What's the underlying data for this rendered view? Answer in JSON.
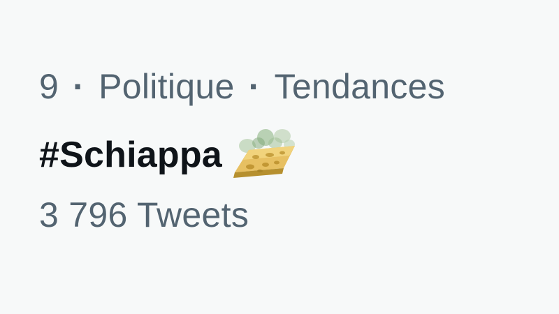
{
  "trend": {
    "rank": "9",
    "separator": "·",
    "category": "Politique",
    "section": "Tendances",
    "hashtag": "#Schiappa",
    "emoji": "cheese-icon",
    "tweet_count": "3 796",
    "tweet_label": "Tweets"
  },
  "colors": {
    "background": "#f7f9f9",
    "secondary_text": "#536471",
    "primary_text": "#0f1419"
  }
}
